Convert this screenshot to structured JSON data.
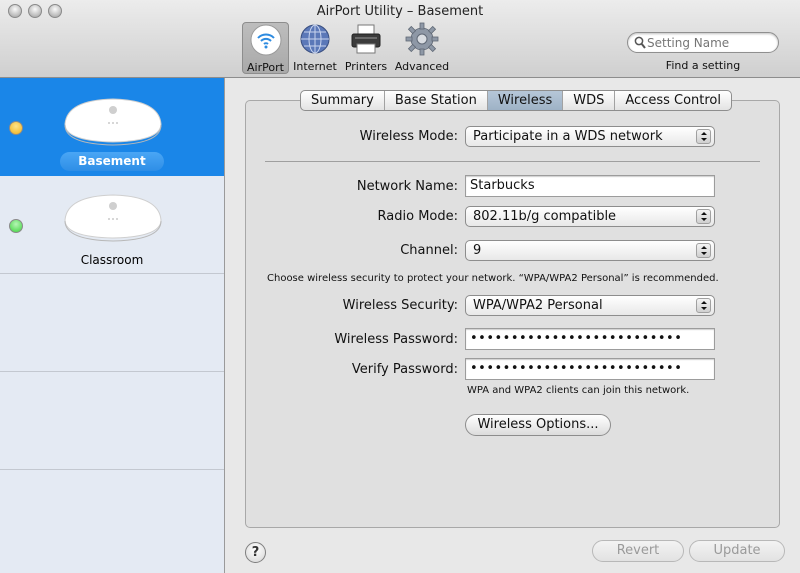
{
  "window": {
    "title": "AirPort Utility – Basement"
  },
  "toolbar": {
    "items": [
      {
        "label": "AirPort",
        "icon": "airport-icon",
        "selected": true
      },
      {
        "label": "Internet",
        "icon": "globe-icon",
        "selected": false
      },
      {
        "label": "Printers",
        "icon": "printer-icon",
        "selected": false
      },
      {
        "label": "Advanced",
        "icon": "gear-icon",
        "selected": false
      }
    ],
    "search": {
      "placeholder": "Setting Name",
      "caption": "Find a setting"
    }
  },
  "sidebar": {
    "devices": [
      {
        "name": "Basement",
        "status_color": "#f2b21a",
        "selected": true
      },
      {
        "name": "Classroom",
        "status_color": "#3dd43d",
        "selected": false
      }
    ]
  },
  "tabs": [
    {
      "label": "Summary",
      "active": false
    },
    {
      "label": "Base Station",
      "active": false
    },
    {
      "label": "Wireless",
      "active": true
    },
    {
      "label": "WDS",
      "active": false
    },
    {
      "label": "Access Control",
      "active": false
    }
  ],
  "form": {
    "wireless_mode": {
      "label": "Wireless Mode:",
      "value": "Participate in a WDS network"
    },
    "network_name": {
      "label": "Network Name:",
      "value": "Starbucks"
    },
    "radio_mode": {
      "label": "Radio Mode:",
      "value": "802.11b/g compatible"
    },
    "channel": {
      "label": "Channel:",
      "value": "9"
    },
    "security_note": "Choose wireless security to protect your network. “WPA/WPA2 Personal” is recommended.",
    "wireless_security": {
      "label": "Wireless Security:",
      "value": "WPA/WPA2 Personal"
    },
    "wireless_password": {
      "label": "Wireless Password:",
      "value": "••••••••••••••••••••••••••"
    },
    "verify_password": {
      "label": "Verify Password:",
      "value": "••••••••••••••••••••••••••"
    },
    "clients_note": "WPA and WPA2 clients can join this network.",
    "wireless_options_button": "Wireless Options..."
  },
  "footer": {
    "help": "?",
    "revert_button": "Revert",
    "update_button": "Update"
  },
  "colors": {
    "selection_blue": "#1a86e8",
    "tab_active": "#aabdd0"
  }
}
